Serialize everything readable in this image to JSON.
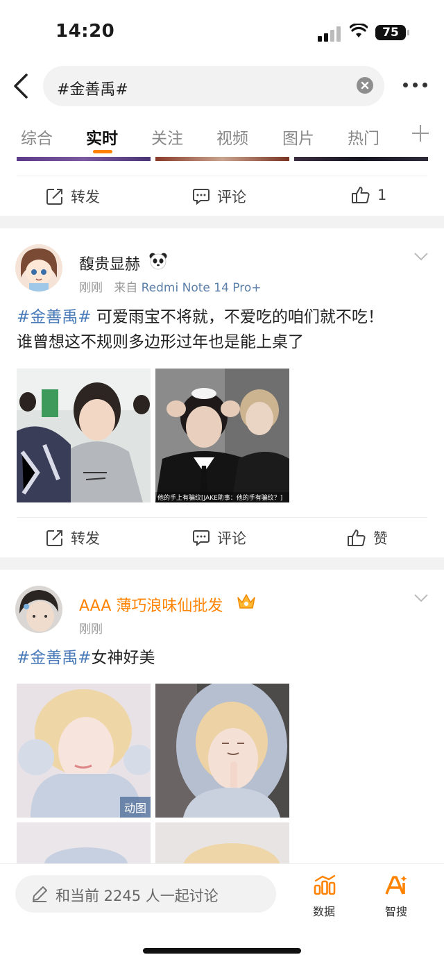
{
  "status_bar": {
    "time": "14:20",
    "battery": "75"
  },
  "search": {
    "query": "#金善禹#"
  },
  "tabs": [
    {
      "label": "综合"
    },
    {
      "label": "实时",
      "active": true
    },
    {
      "label": "关注"
    },
    {
      "label": "视频"
    },
    {
      "label": "图片"
    },
    {
      "label": "热门"
    }
  ],
  "prev_post": {
    "actions": {
      "repost": "转发",
      "comment": "评论",
      "like_count": "1"
    }
  },
  "post1": {
    "username": "馥贵显赫",
    "badge": "panda-icon",
    "time": "刚刚",
    "source_prefix": "来自",
    "source": "Redmi Note 14 Pro+",
    "hashtag": "#金善禹#",
    "text_line1": " 可爱雨宝不将就，不爱吃的咱们就不吃！",
    "text_line2": "谁曾想这不规则多边形过年也是能上桌了",
    "image2_caption": "他的手上有骗纹[JAKE助事：他的手有骗纹？]",
    "actions": {
      "repost": "转发",
      "comment": "评论",
      "like": "赞"
    }
  },
  "post2": {
    "username": "AAA 薄巧浪味仙批发",
    "badge": "crown-icon",
    "time": "刚刚",
    "hashtag": "#金善禹#",
    "text": "女神好美",
    "gif_badge": "动图"
  },
  "bottom_bar": {
    "discuss_placeholder": "和当前 2245 人一起讨论",
    "data_label": "数据",
    "smart_label": "智搜",
    "accent": "#ff8200"
  }
}
